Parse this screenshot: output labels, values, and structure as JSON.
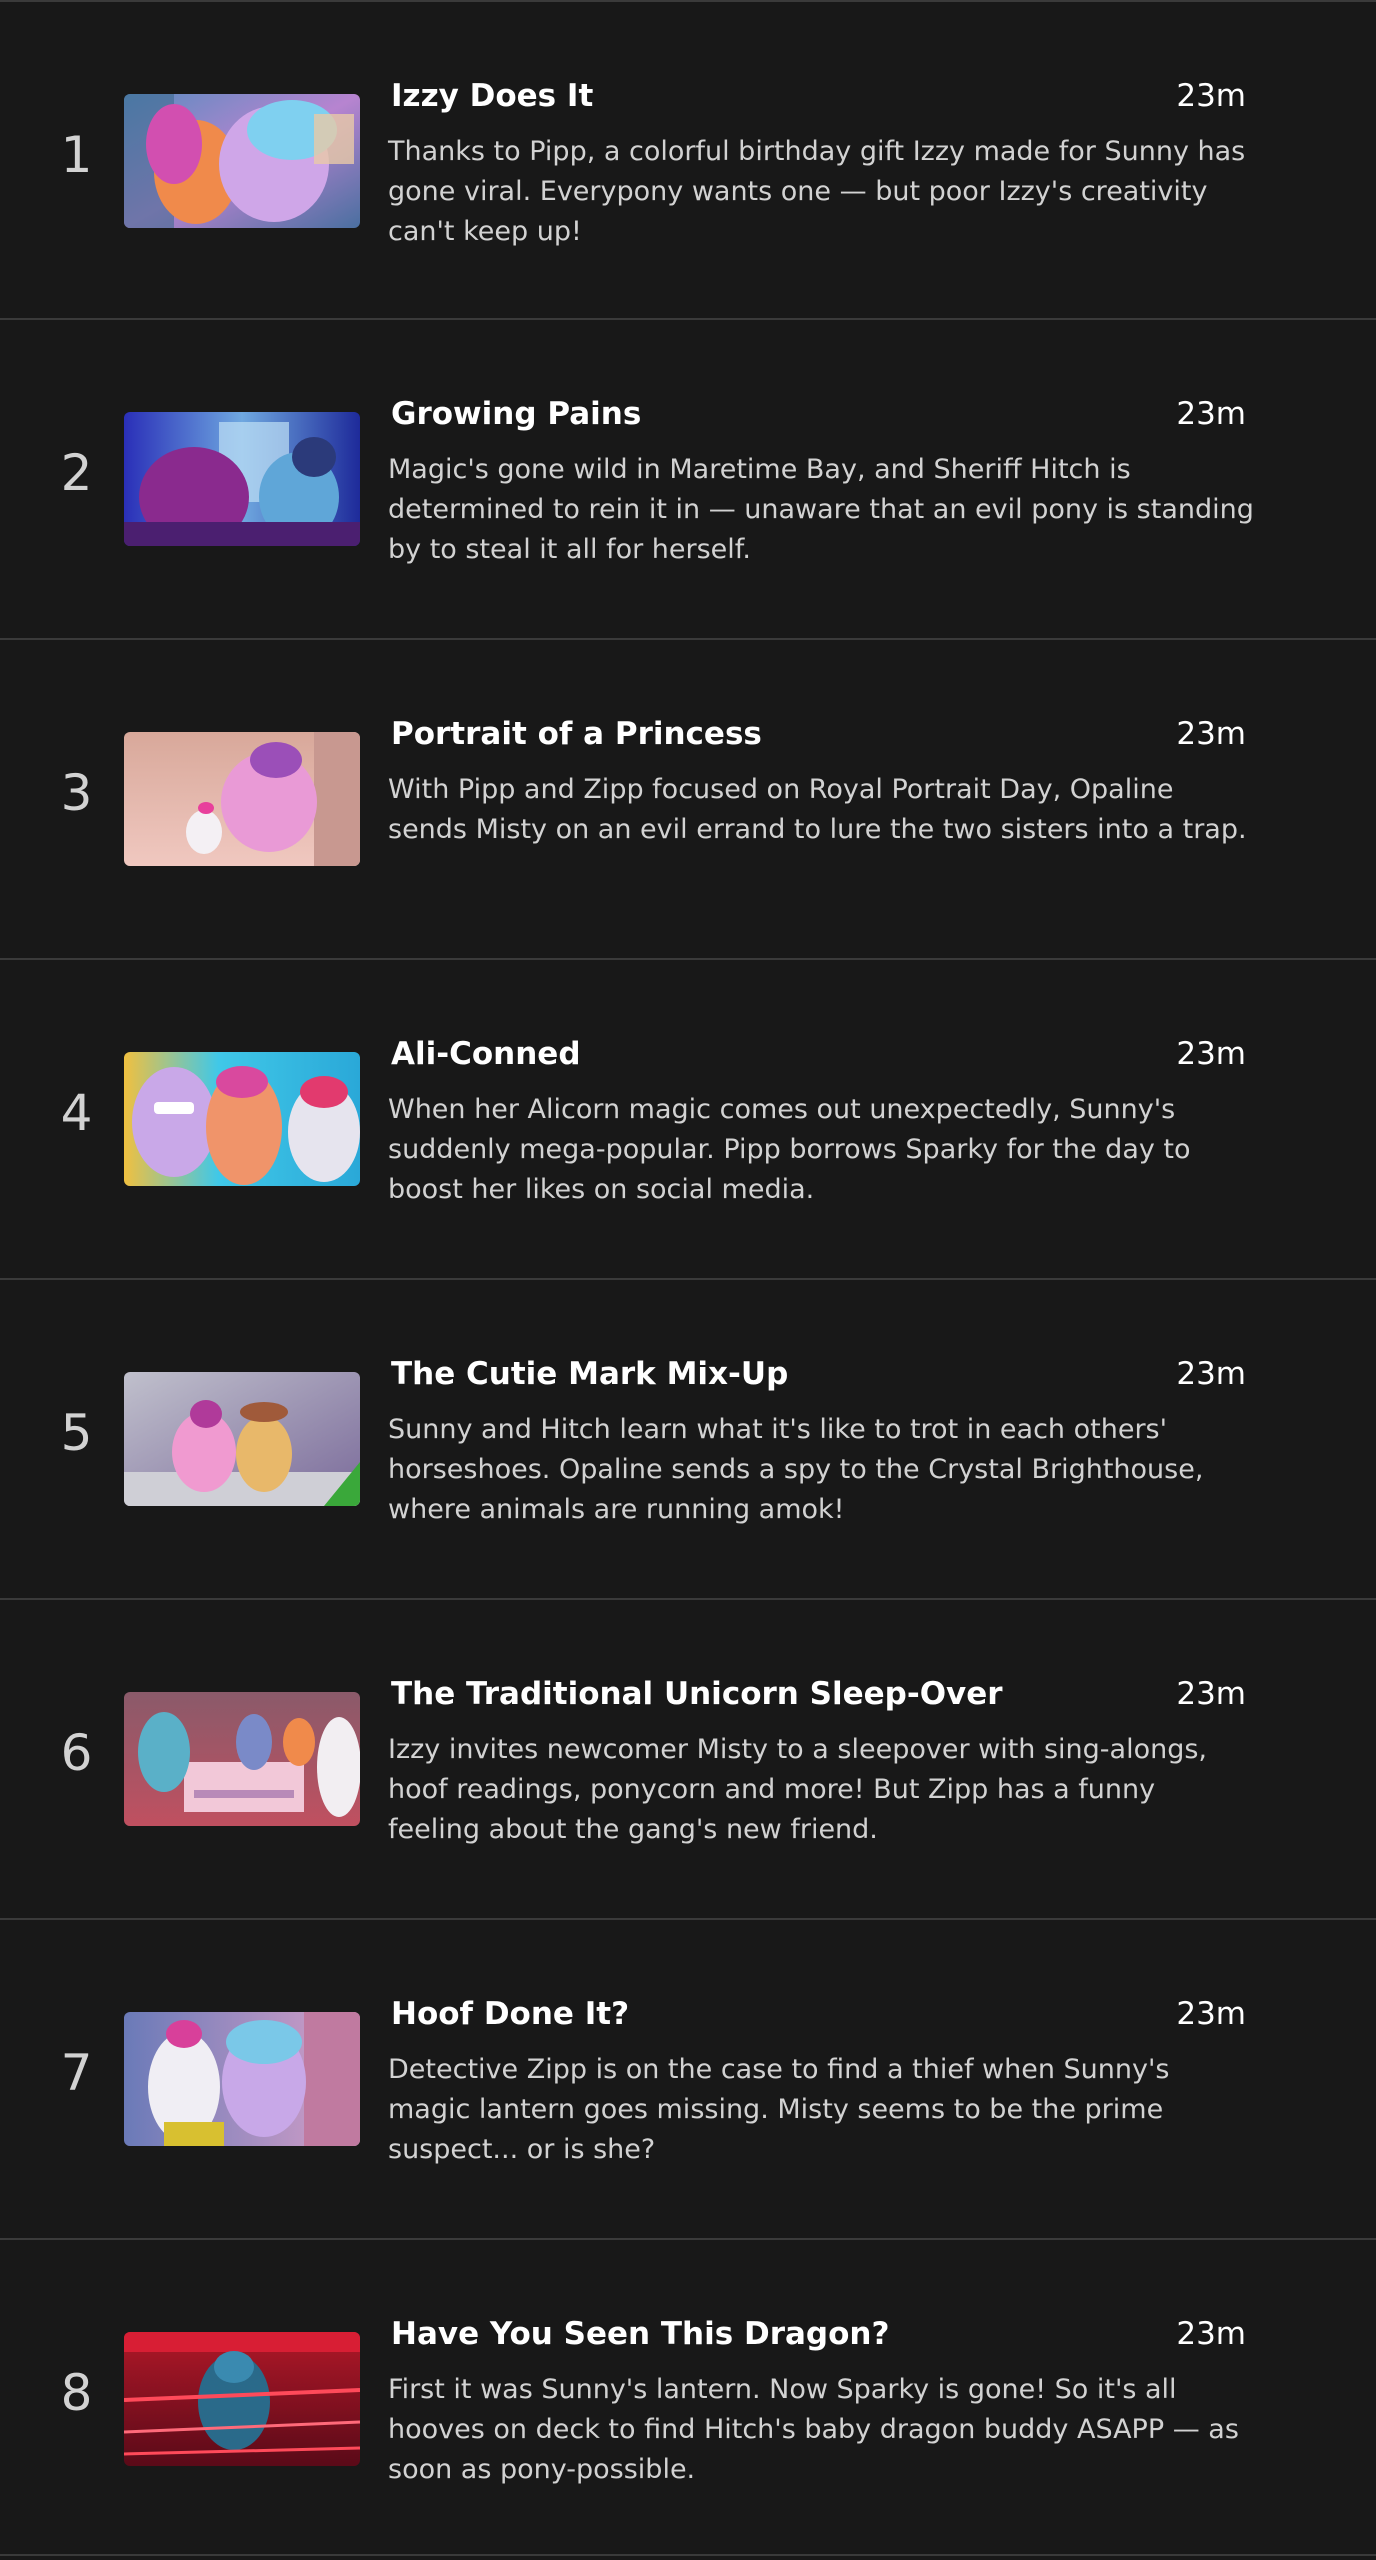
{
  "episodes": [
    {
      "number": "1",
      "title": "Izzy Does It",
      "runtime": "23m",
      "synopsis": "Thanks to Pipp, a colorful birthday gift Izzy made for Sunny has gone viral. Everypony wants one — but poor Izzy's creativity can't keep up!"
    },
    {
      "number": "2",
      "title": "Growing Pains",
      "runtime": "23m",
      "synopsis": "Magic's gone wild in Maretime Bay, and Sheriff Hitch is determined to rein it in — unaware that an evil pony is standing by to steal it all for herself."
    },
    {
      "number": "3",
      "title": "Portrait of a Princess",
      "runtime": "23m",
      "synopsis": "With Pipp and Zipp focused on Royal Portrait Day, Opaline sends Misty on an evil errand to lure the two sisters into a trap."
    },
    {
      "number": "4",
      "title": "Ali-Conned",
      "runtime": "23m",
      "synopsis": "When her Alicorn magic comes out unexpectedly, Sunny's suddenly mega-popular. Pipp borrows Sparky for the day to boost her likes on social media."
    },
    {
      "number": "5",
      "title": "The Cutie Mark Mix-Up",
      "runtime": "23m",
      "synopsis": "Sunny and Hitch learn what it's like to trot in each others' horseshoes. Opaline sends a spy to the Crystal Brighthouse, where animals are running amok!"
    },
    {
      "number": "6",
      "title": "The Traditional Unicorn Sleep-Over",
      "runtime": "23m",
      "synopsis": "Izzy invites newcomer Misty to a sleepover with sing-alongs, hoof readings, ponycorn and more! But Zipp has a funny feeling about the gang's new friend."
    },
    {
      "number": "7",
      "title": "Hoof Done It?",
      "runtime": "23m",
      "synopsis": "Detective Zipp is on the case to find a thief when Sunny's magic lantern goes missing. Misty seems to be the prime suspect... or is she?"
    },
    {
      "number": "8",
      "title": "Have You Seen This Dragon?",
      "runtime": "23m",
      "synopsis": "First it was Sunny's lantern. Now Sparky is gone! So it's all hooves on deck to find Hitch's baby dragon buddy ASAPP — as soon as pony-possible."
    }
  ]
}
